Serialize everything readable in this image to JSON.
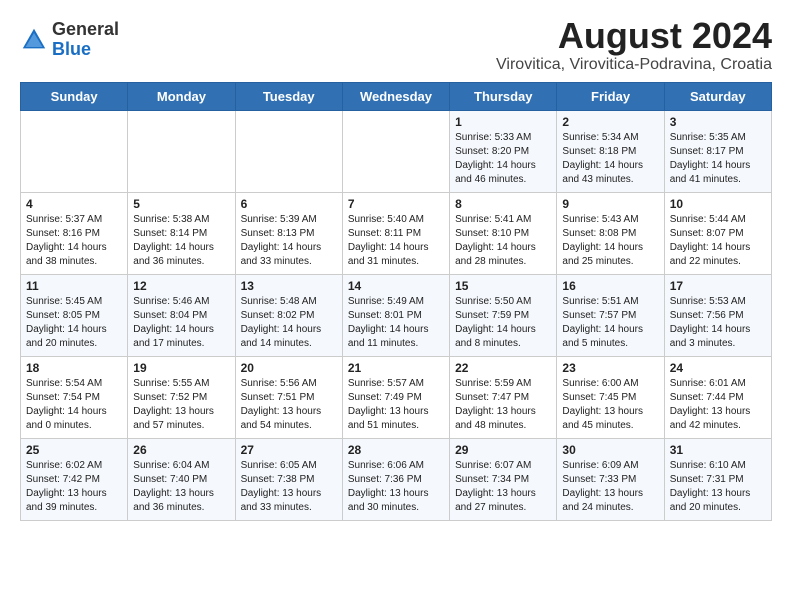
{
  "header": {
    "logo_general": "General",
    "logo_blue": "Blue",
    "title": "August 2024",
    "subtitle": "Virovitica, Virovitica-Podravina, Croatia"
  },
  "days_of_week": [
    "Sunday",
    "Monday",
    "Tuesday",
    "Wednesday",
    "Thursday",
    "Friday",
    "Saturday"
  ],
  "weeks": [
    [
      {
        "day": "",
        "info": ""
      },
      {
        "day": "",
        "info": ""
      },
      {
        "day": "",
        "info": ""
      },
      {
        "day": "",
        "info": ""
      },
      {
        "day": "1",
        "info": "Sunrise: 5:33 AM\nSunset: 8:20 PM\nDaylight: 14 hours\nand 46 minutes."
      },
      {
        "day": "2",
        "info": "Sunrise: 5:34 AM\nSunset: 8:18 PM\nDaylight: 14 hours\nand 43 minutes."
      },
      {
        "day": "3",
        "info": "Sunrise: 5:35 AM\nSunset: 8:17 PM\nDaylight: 14 hours\nand 41 minutes."
      }
    ],
    [
      {
        "day": "4",
        "info": "Sunrise: 5:37 AM\nSunset: 8:16 PM\nDaylight: 14 hours\nand 38 minutes."
      },
      {
        "day": "5",
        "info": "Sunrise: 5:38 AM\nSunset: 8:14 PM\nDaylight: 14 hours\nand 36 minutes."
      },
      {
        "day": "6",
        "info": "Sunrise: 5:39 AM\nSunset: 8:13 PM\nDaylight: 14 hours\nand 33 minutes."
      },
      {
        "day": "7",
        "info": "Sunrise: 5:40 AM\nSunset: 8:11 PM\nDaylight: 14 hours\nand 31 minutes."
      },
      {
        "day": "8",
        "info": "Sunrise: 5:41 AM\nSunset: 8:10 PM\nDaylight: 14 hours\nand 28 minutes."
      },
      {
        "day": "9",
        "info": "Sunrise: 5:43 AM\nSunset: 8:08 PM\nDaylight: 14 hours\nand 25 minutes."
      },
      {
        "day": "10",
        "info": "Sunrise: 5:44 AM\nSunset: 8:07 PM\nDaylight: 14 hours\nand 22 minutes."
      }
    ],
    [
      {
        "day": "11",
        "info": "Sunrise: 5:45 AM\nSunset: 8:05 PM\nDaylight: 14 hours\nand 20 minutes."
      },
      {
        "day": "12",
        "info": "Sunrise: 5:46 AM\nSunset: 8:04 PM\nDaylight: 14 hours\nand 17 minutes."
      },
      {
        "day": "13",
        "info": "Sunrise: 5:48 AM\nSunset: 8:02 PM\nDaylight: 14 hours\nand 14 minutes."
      },
      {
        "day": "14",
        "info": "Sunrise: 5:49 AM\nSunset: 8:01 PM\nDaylight: 14 hours\nand 11 minutes."
      },
      {
        "day": "15",
        "info": "Sunrise: 5:50 AM\nSunset: 7:59 PM\nDaylight: 14 hours\nand 8 minutes."
      },
      {
        "day": "16",
        "info": "Sunrise: 5:51 AM\nSunset: 7:57 PM\nDaylight: 14 hours\nand 5 minutes."
      },
      {
        "day": "17",
        "info": "Sunrise: 5:53 AM\nSunset: 7:56 PM\nDaylight: 14 hours\nand 3 minutes."
      }
    ],
    [
      {
        "day": "18",
        "info": "Sunrise: 5:54 AM\nSunset: 7:54 PM\nDaylight: 14 hours\nand 0 minutes."
      },
      {
        "day": "19",
        "info": "Sunrise: 5:55 AM\nSunset: 7:52 PM\nDaylight: 13 hours\nand 57 minutes."
      },
      {
        "day": "20",
        "info": "Sunrise: 5:56 AM\nSunset: 7:51 PM\nDaylight: 13 hours\nand 54 minutes."
      },
      {
        "day": "21",
        "info": "Sunrise: 5:57 AM\nSunset: 7:49 PM\nDaylight: 13 hours\nand 51 minutes."
      },
      {
        "day": "22",
        "info": "Sunrise: 5:59 AM\nSunset: 7:47 PM\nDaylight: 13 hours\nand 48 minutes."
      },
      {
        "day": "23",
        "info": "Sunrise: 6:00 AM\nSunset: 7:45 PM\nDaylight: 13 hours\nand 45 minutes."
      },
      {
        "day": "24",
        "info": "Sunrise: 6:01 AM\nSunset: 7:44 PM\nDaylight: 13 hours\nand 42 minutes."
      }
    ],
    [
      {
        "day": "25",
        "info": "Sunrise: 6:02 AM\nSunset: 7:42 PM\nDaylight: 13 hours\nand 39 minutes."
      },
      {
        "day": "26",
        "info": "Sunrise: 6:04 AM\nSunset: 7:40 PM\nDaylight: 13 hours\nand 36 minutes."
      },
      {
        "day": "27",
        "info": "Sunrise: 6:05 AM\nSunset: 7:38 PM\nDaylight: 13 hours\nand 33 minutes."
      },
      {
        "day": "28",
        "info": "Sunrise: 6:06 AM\nSunset: 7:36 PM\nDaylight: 13 hours\nand 30 minutes."
      },
      {
        "day": "29",
        "info": "Sunrise: 6:07 AM\nSunset: 7:34 PM\nDaylight: 13 hours\nand 27 minutes."
      },
      {
        "day": "30",
        "info": "Sunrise: 6:09 AM\nSunset: 7:33 PM\nDaylight: 13 hours\nand 24 minutes."
      },
      {
        "day": "31",
        "info": "Sunrise: 6:10 AM\nSunset: 7:31 PM\nDaylight: 13 hours\nand 20 minutes."
      }
    ]
  ]
}
